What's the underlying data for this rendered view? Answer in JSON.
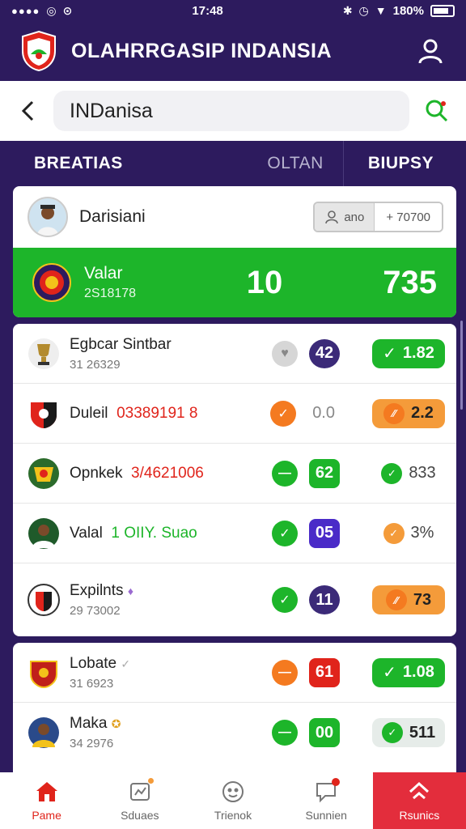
{
  "status": {
    "time": "17:48",
    "battery": "180%"
  },
  "header": {
    "title": "OLAHRRGASIP INDANSIA",
    "logo": "shield-logo",
    "user_icon": "user-icon"
  },
  "search": {
    "value": "INDanisa"
  },
  "tabs": [
    {
      "label": "BREATIAS"
    },
    {
      "label": "OLTAN"
    },
    {
      "label": "BIUPSY"
    }
  ],
  "featured": {
    "name": "Darisiani",
    "follow_label": "ano",
    "follow_count": "+ 70700",
    "team": "Valar",
    "code": "2S18178",
    "score_a": "10",
    "score_b": "735",
    "accent": "#1db52a"
  },
  "list": [
    {
      "name": "Egbcar Sintbar",
      "sub": "31 26329",
      "score": "42",
      "odds": "1.82"
    },
    {
      "name": "Duleil",
      "code": "03389191 8",
      "score": "0.0",
      "odds": "2.2"
    },
    {
      "name": "Opnkek",
      "code": "3/4621006",
      "score": "62",
      "odds": "833"
    },
    {
      "name": "Valal",
      "code": "1 OIIY. Suao",
      "score": "05",
      "odds": "3%"
    },
    {
      "name": "Expilnts",
      "sub": "29 73002",
      "score": "11",
      "odds": "73"
    }
  ],
  "list2": [
    {
      "name": "Lobate",
      "sub": "31 6923",
      "score": "61",
      "odds": "1.08"
    },
    {
      "name": "Maka",
      "sub": "34 2976",
      "score": "00",
      "odds": "511"
    }
  ],
  "nav": [
    {
      "label": "Pame",
      "icon": "home-icon"
    },
    {
      "label": "Sduaes",
      "icon": "stats-icon"
    },
    {
      "label": "Trienok",
      "icon": "smile-icon"
    },
    {
      "label": "Sunnien",
      "icon": "chat-icon"
    },
    {
      "label": "Rsunics",
      "icon": "trophy-icon"
    }
  ],
  "colors": {
    "brand": "#2d1b5e",
    "green": "#1db52a",
    "orange": "#f47a20",
    "red": "#e0241b"
  }
}
